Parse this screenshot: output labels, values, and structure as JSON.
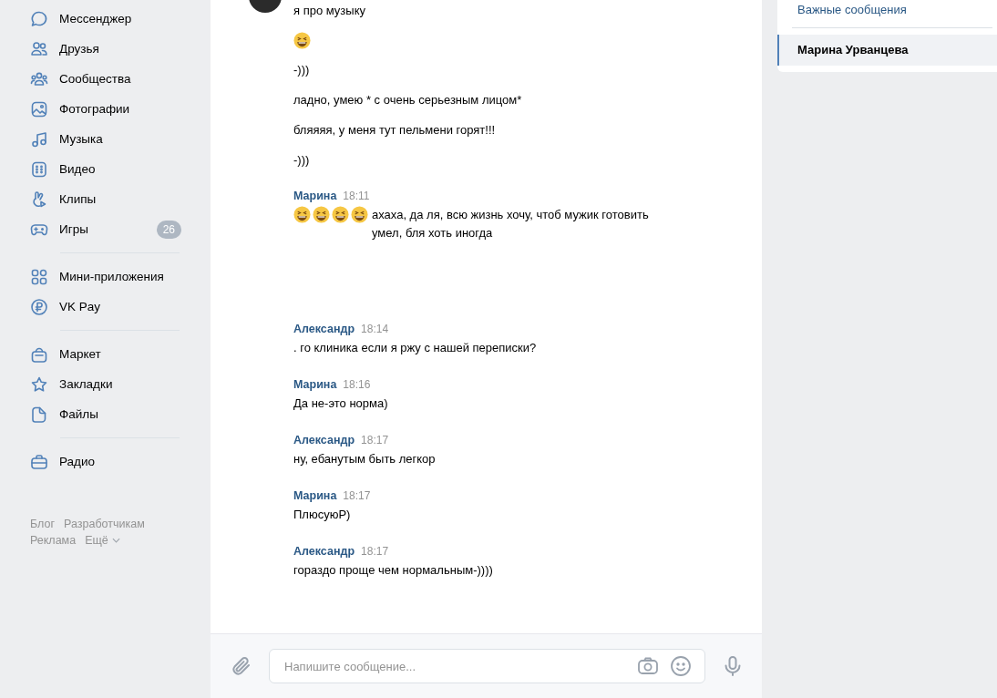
{
  "sidebar": {
    "items": [
      {
        "label": "Мессенджер"
      },
      {
        "label": "Друзья"
      },
      {
        "label": "Сообщества"
      },
      {
        "label": "Фотографии"
      },
      {
        "label": "Музыка"
      },
      {
        "label": "Видео"
      },
      {
        "label": "Клипы"
      },
      {
        "label": "Игры",
        "badge": "26"
      },
      {
        "kind": "divider"
      },
      {
        "label": "Мини-приложения"
      },
      {
        "label": "VK Pay"
      },
      {
        "kind": "divider"
      },
      {
        "label": "Маркет"
      },
      {
        "label": "Закладки"
      },
      {
        "label": "Файлы"
      },
      {
        "kind": "divider"
      },
      {
        "label": "Радио"
      }
    ],
    "footer": [
      [
        "Блог",
        "Разработчикам"
      ],
      [
        "Реклама",
        "Ещё"
      ]
    ]
  },
  "chat": {
    "groups": [
      {
        "lines": [
          [
            {
              "kind": "text",
              "text": "я про музыку"
            }
          ],
          [
            {
              "kind": "emoji"
            }
          ],
          [
            {
              "kind": "text",
              "text": "-)))"
            }
          ],
          [
            {
              "kind": "text",
              "text": "ладно, умею * с очень серьезным лицом*"
            }
          ],
          [
            {
              "kind": "text",
              "text": "бляяяя, у меня тут пельмени горят!!!"
            }
          ],
          [
            {
              "kind": "text",
              "text": "-)))"
            }
          ]
        ]
      },
      {
        "author": "Марина",
        "time": "18:11",
        "lines": [
          [
            {
              "kind": "emoji"
            },
            {
              "kind": "emoji"
            },
            {
              "kind": "emoji"
            },
            {
              "kind": "emoji"
            },
            {
              "kind": "text",
              "text": "ахаха, да ля, всю жизнь хочу, чтоб мужик готовить умел, бля хоть иногда"
            }
          ]
        ]
      },
      {
        "author": "Александр",
        "time": "18:14",
        "lines": [
          [
            {
              "kind": "text",
              "text": ". го клиника если я ржу с нашей переписки?"
            }
          ]
        ]
      },
      {
        "author": "Марина",
        "time": "18:16",
        "lines": [
          [
            {
              "kind": "text",
              "text": "Да не-это норма)"
            }
          ]
        ]
      },
      {
        "author": "Александр",
        "time": "18:17",
        "lines": [
          [
            {
              "kind": "text",
              "text": "ну, ебанутым быть легкор"
            }
          ]
        ]
      },
      {
        "author": "Марина",
        "time": "18:17",
        "lines": [
          [
            {
              "kind": "text",
              "text": "ПлюсуюР)"
            }
          ]
        ]
      },
      {
        "author": "Александр",
        "time": "18:17",
        "lines": [
          [
            {
              "kind": "text",
              "text": "гораздо проще чем нормальным-))))"
            }
          ]
        ]
      }
    ],
    "composer": {
      "placeholder": "Напишите сообщение..."
    }
  },
  "right_panel": {
    "items": [
      {
        "label": "Важные сообщения",
        "selected": false
      },
      {
        "label": "Марина Урванцева",
        "selected": true
      }
    ]
  }
}
